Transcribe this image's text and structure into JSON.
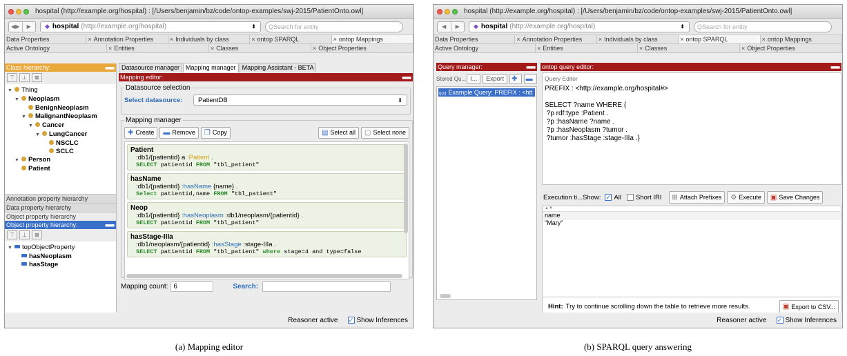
{
  "window_title": "hospital (http://example.org/hospital)  : [/Users/benjamin/bz/code/ontop-examples/swj-2015/PatientOnto.owl]",
  "ontology_selector": {
    "name": "hospital",
    "iri": "(http://example.org/hospital)"
  },
  "search_placeholder": "Search for entity",
  "tabs_row1": [
    "Data Properties",
    "Annotation Properties",
    "Individuals by class",
    "ontop SPARQL",
    "ontop Mappings"
  ],
  "tabs_row2": [
    "Active Ontology",
    "Entities",
    "Classes",
    "Object Properties"
  ],
  "status": {
    "reasoner": "Reasoner active",
    "show_inferences": "Show Inferences"
  },
  "panel_a": {
    "class_hierarchy": {
      "title": "Class hierarchy:",
      "nodes": [
        "Thing",
        "Neoplasm",
        "BenignNeoplasm",
        "MalignantNeoplasm",
        "Cancer",
        "LungCancer",
        "NSCLC",
        "SCLC",
        "Person",
        "Patient"
      ]
    },
    "stacked_tabs": [
      "Annotation property hierarchy",
      "Data property hierarchy",
      "Object property hierarchy"
    ],
    "object_property_hierarchy": {
      "title": "Object property hierarchy:",
      "nodes": [
        "topObjectProperty",
        "hasNeoplasm",
        "hasStage"
      ]
    },
    "subtabs": [
      "Datasource manager",
      "Mapping manager",
      "Mapping Assistant - BETA"
    ],
    "mapping_editor_title": "Mapping editor:",
    "datasource_selection": {
      "legend": "Datasource selection",
      "label": "Select datasource:",
      "value": "PatientDB"
    },
    "mapping_manager": {
      "legend": "Mapping manager",
      "buttons": {
        "create": "Create",
        "remove": "Remove",
        "copy": "Copy",
        "select_all": "Select all",
        "select_none": "Select none"
      },
      "mappings": [
        {
          "name": "Patient",
          "t1": ":db1/{patientid} a ",
          "t2": ":Patient",
          "t3": " .",
          "sql": [
            [
              "SELECT",
              " patientid "
            ],
            [
              "FROM",
              " \"tbl_patient\""
            ]
          ]
        },
        {
          "name": "hasName",
          "t1": ":db1/{patientid} ",
          "t2": ":hasName",
          "t3": " {name} .",
          "sql": [
            [
              "Select",
              " patientid,name "
            ],
            [
              "FROM",
              " \"tbl_patient\""
            ]
          ]
        },
        {
          "name": "Neop",
          "t1": ":db1/{patientid} ",
          "t2": ":hasNeoplasm",
          "t3": " :db1/neoplasm/{patientid} .",
          "sql": [
            [
              "SELECT",
              " patientid "
            ],
            [
              "FROM",
              " \"tbl_patient\""
            ]
          ]
        },
        {
          "name": "hasStage-IIIa",
          "t1": ":db1/neoplasm/{patientid} ",
          "t2": ":hasStage",
          "t3": " :stage-IIIa .",
          "sql": [
            [
              "SELECT",
              " patientid "
            ],
            [
              "FROM",
              " \"tbl_patient\" "
            ],
            [
              "where",
              " stage=4 and type=false"
            ]
          ]
        }
      ],
      "count_label": "Mapping count:",
      "count": "6",
      "search_label": "Search:"
    },
    "caption": "(a) Mapping editor"
  },
  "panel_b": {
    "query_manager_title": "Query manager:",
    "stored_label": "Stored Qu...",
    "import_label": "I...",
    "export_label": "Export",
    "query_item": "Example Query: PREFIX : <htt",
    "query_editor_title": "ontop query editor:",
    "query_editor_label": "Query Editor",
    "query_lines": [
      "PREFIX : <http://example.org/hospital#>",
      "",
      "SELECT ?name WHERE {",
      " ?p rdf:type :Patient .",
      " ?p :hasName ?name .",
      " ?p :hasNeoplasm ?tumor .",
      " ?tumor :hasStage :stage-IIIa .}"
    ],
    "exec_label": "Execution ti...Show:",
    "all_label": "All",
    "short_iri_label": "Short IRI",
    "attach_prefixes": "Attach Prefixes",
    "execute": "Execute",
    "save_changes": "Save Changes",
    "result_header": "name",
    "result_rows": [
      "\"Mary\""
    ],
    "hint_label": "Hint:",
    "hint_text": "Try to continue scrolling down the table to retrieve more results.",
    "export_csv": "Export to CSV...",
    "caption": "(b) SPARQL query answering"
  }
}
